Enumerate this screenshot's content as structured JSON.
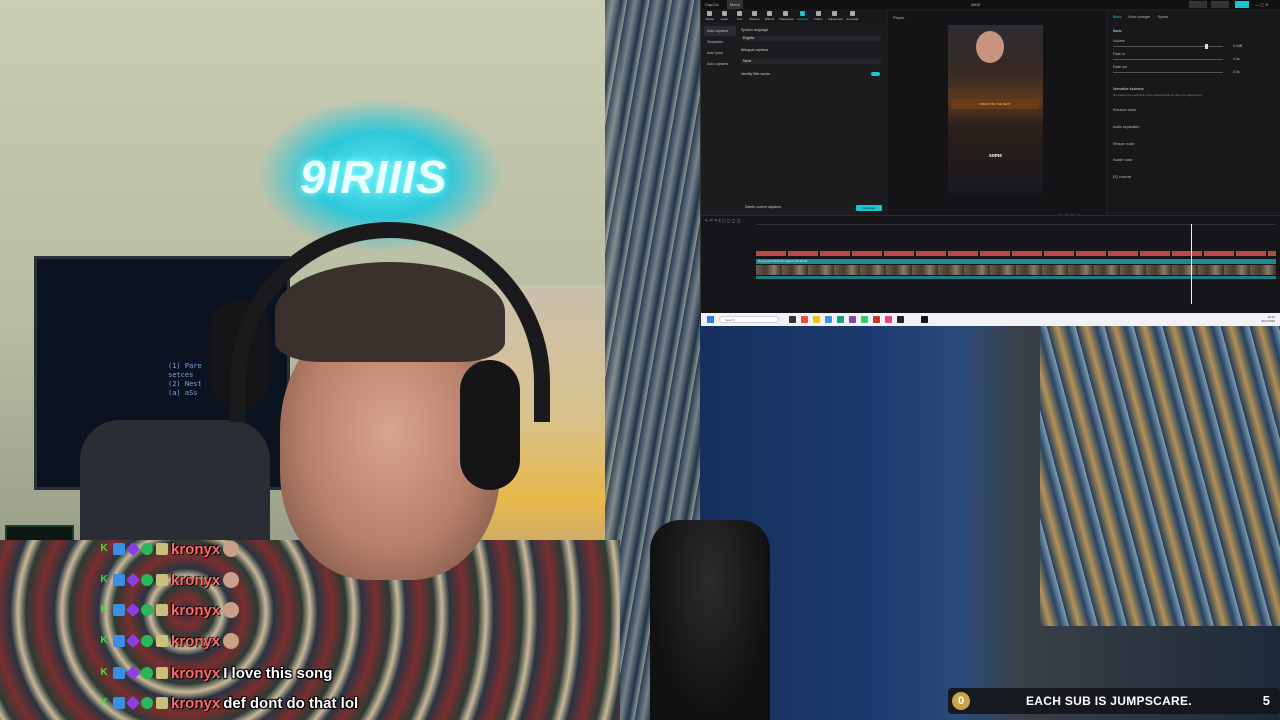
{
  "stream": {
    "neon_sign": "9IRIIIS",
    "tv_text": "(1) Pare\nsetces\n(2) Nest\n(a) aSs"
  },
  "editor": {
    "window_title": "CapCut",
    "menu_label": "Menu",
    "project_name": "0808",
    "toolbar": [
      {
        "label": "Media",
        "icon": "media-icon"
      },
      {
        "label": "Audio",
        "icon": "audio-icon"
      },
      {
        "label": "Text",
        "icon": "text-icon"
      },
      {
        "label": "Stickers",
        "icon": "stickers-icon"
      },
      {
        "label": "Effects",
        "icon": "effects-icon"
      },
      {
        "label": "Transitions",
        "icon": "transitions-icon"
      },
      {
        "label": "Captions",
        "icon": "captions-icon"
      },
      {
        "label": "Filters",
        "icon": "filters-icon"
      },
      {
        "label": "Adjustment",
        "icon": "adjustment-icon"
      },
      {
        "label": "AI avatar",
        "icon": "ai-avatar-icon"
      }
    ],
    "left_nav": [
      {
        "label": "Auto captions",
        "active": true
      },
      {
        "label": "Templates",
        "active": false
      },
      {
        "label": "Auto lyrics",
        "active": false
      },
      {
        "label": "Auto captions",
        "active": false
      }
    ],
    "captions": {
      "spoken_language_label": "Spoken language",
      "spoken_language_value": "English",
      "bilingual_label": "Bilingual captions",
      "bilingual_value": "None",
      "filler_words_label": "Identify filler words",
      "clear_label": "Delete current captions",
      "generate_button": "Generate"
    },
    "player": {
      "title": "Player",
      "time_current": "00:00:00:00",
      "time_total": "00:00:00:00",
      "preview_subtitle": "some",
      "preview_logo": "I MIGHT BE THE NEXT"
    },
    "properties": {
      "tabs": [
        "Basic",
        "Voice changer",
        "Speed"
      ],
      "section_basic": "Basic",
      "volume_label": "Volume",
      "volume_value": "0.0dB",
      "fade_in_label": "Fade in",
      "fade_in_value": "0.0s",
      "fade_out_label": "Fade out",
      "fade_out_value": "0.0s",
      "normalize_label": "Normalize loudness",
      "normalize_desc": "Normalize the loudness of the selected clip or clips to a target level.",
      "options": [
        "Enhance voice",
        "Audio separation",
        "Reduce noise",
        "Isolate voice",
        "EQ channel"
      ]
    },
    "timeline": {
      "clip_label": "Copy.mp4 00:20:11 CapCut 00:00:00"
    },
    "taskbar": {
      "search_placeholder": "Search",
      "clock_time": "10:31",
      "clock_date": "8/17/2024"
    },
    "accent": "#1cc4cf"
  },
  "chat": [
    {
      "user": "kronyx",
      "message": "",
      "emote": true
    },
    {
      "user": "kronyx",
      "message": "",
      "emote": true
    },
    {
      "user": "kronyx",
      "message": "",
      "emote": true
    },
    {
      "user": "kronyx",
      "message": "",
      "emote": true
    },
    {
      "user": "kronyx",
      "message": "I love this song",
      "emote": false
    },
    {
      "user": "kronyx",
      "message": "def dont do that lol",
      "emote": false
    }
  ],
  "goal": {
    "current": "0",
    "text": "EACH SUB IS JUMPSCARE.",
    "target": "5"
  }
}
